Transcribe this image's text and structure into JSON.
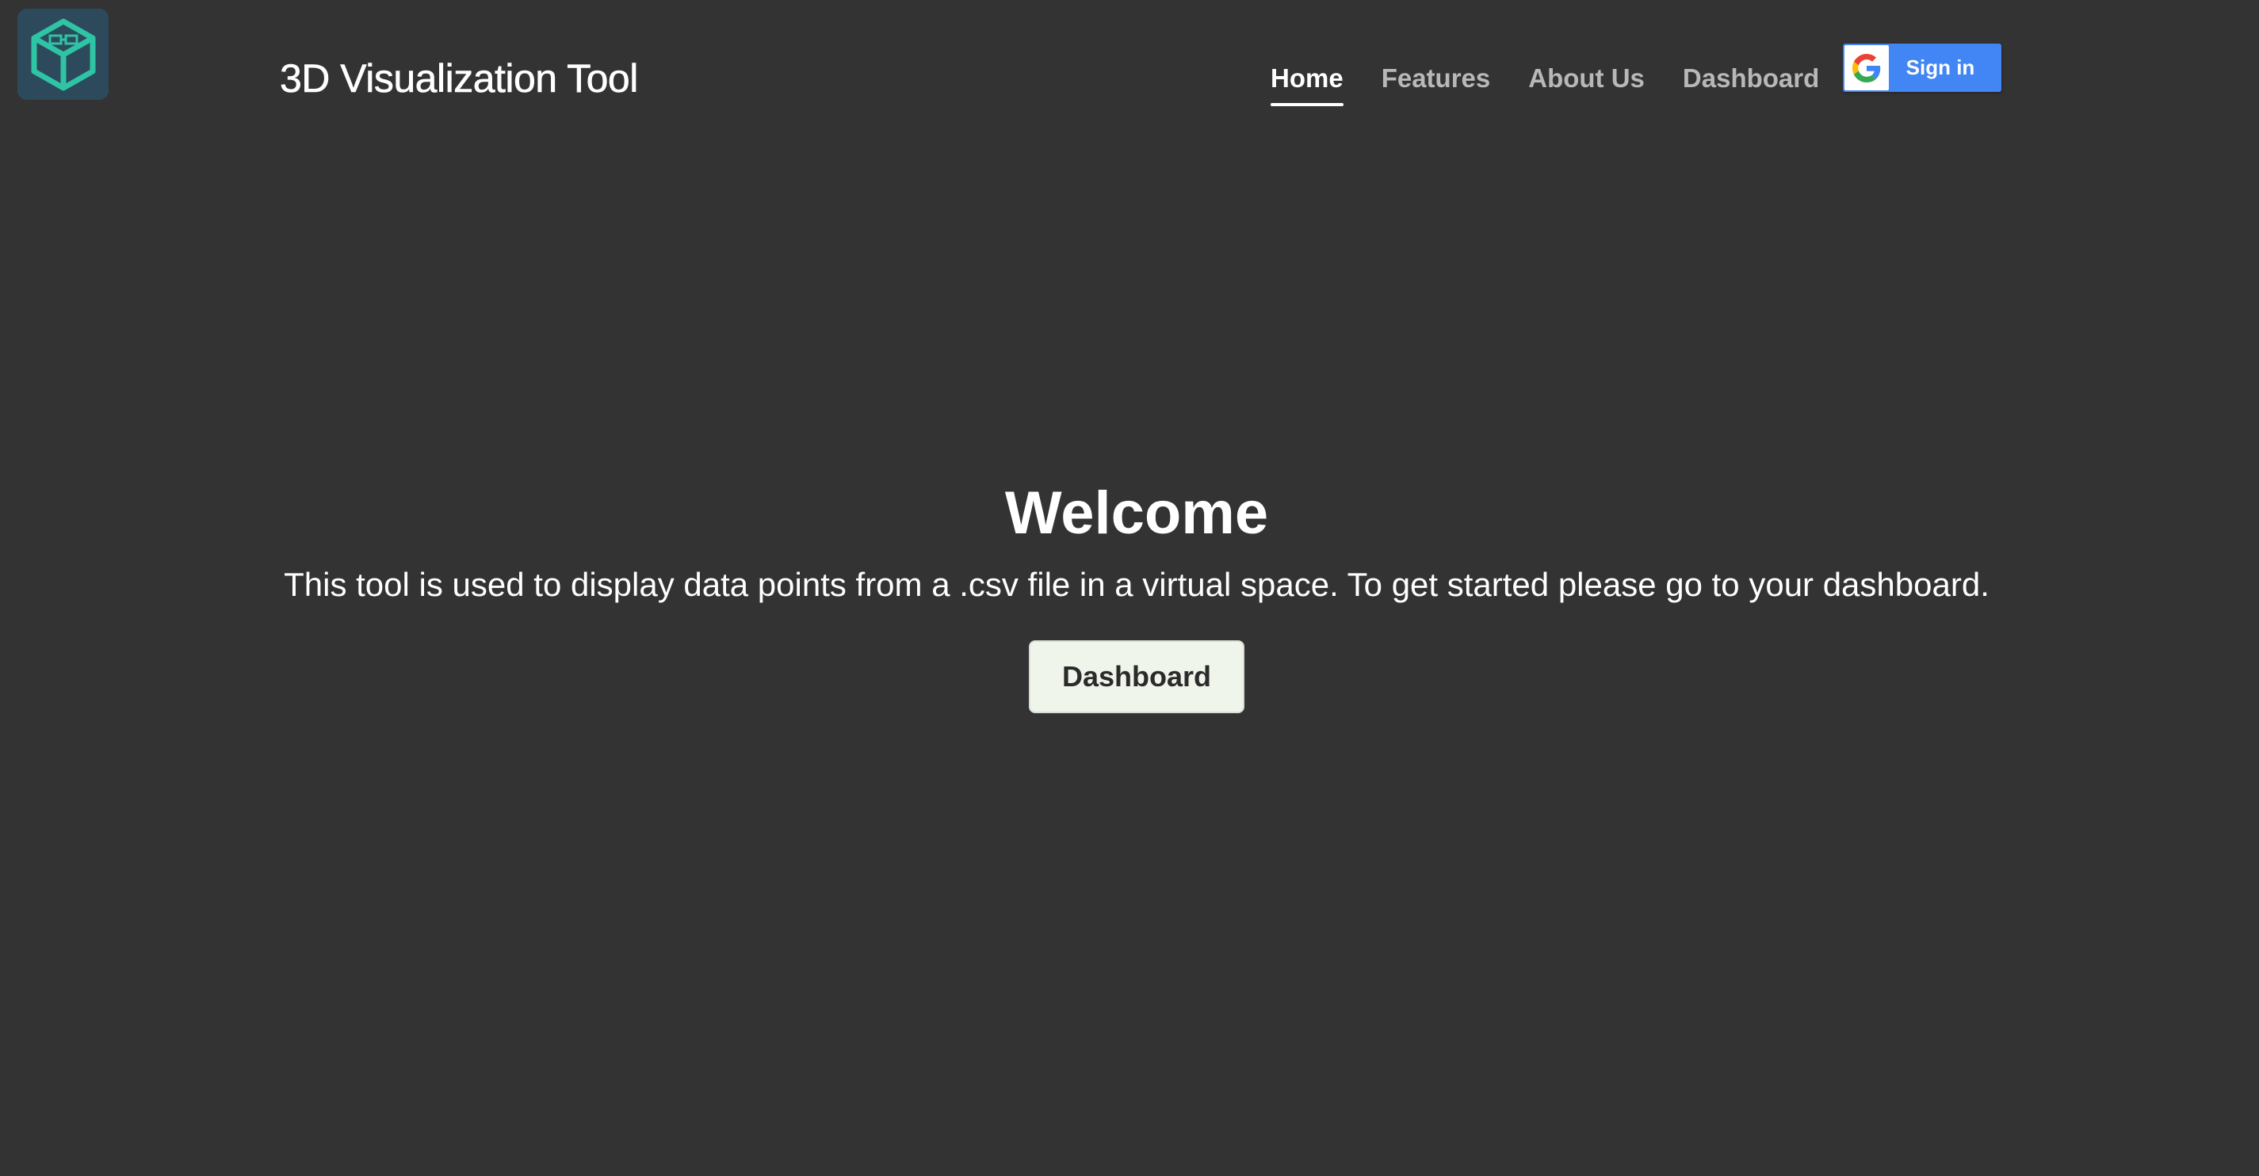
{
  "header": {
    "logo_icon": "cube-icon",
    "title": "3D Visualization Tool"
  },
  "nav": {
    "items": [
      {
        "label": "Home",
        "active": true
      },
      {
        "label": "Features",
        "active": false
      },
      {
        "label": "About Us",
        "active": false
      },
      {
        "label": "Dashboard",
        "active": false
      }
    ]
  },
  "signin": {
    "icon": "google-icon",
    "label": "Sign in",
    "color": "#4285f4"
  },
  "hero": {
    "title": "Welcome",
    "text": "This tool is used to display data points from a .csv file in a virtual space. To get started please go to your dashboard.",
    "button_label": "Dashboard"
  },
  "colors": {
    "background": "#333333",
    "accent": "#2ec4a5"
  }
}
